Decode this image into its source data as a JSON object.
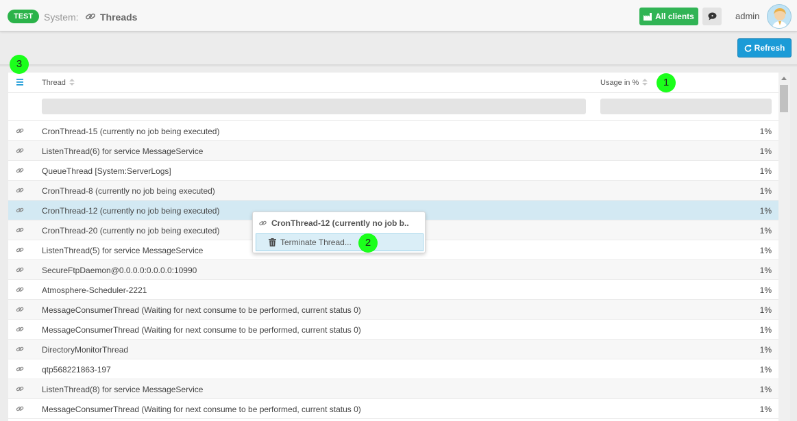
{
  "header": {
    "env_badge": "TEST",
    "breadcrumb_system": "System:",
    "breadcrumb_title": "Threads",
    "all_clients_label": "All clients",
    "user_name": "admin"
  },
  "toolbar": {
    "refresh_label": "Refresh"
  },
  "markers": {
    "m1": "1",
    "m2": "2",
    "m3": "3"
  },
  "table": {
    "columns": {
      "thread": "Thread",
      "usage": "Usage in %"
    },
    "rows": [
      {
        "name": "CronThread-15 (currently no job being executed)",
        "usage": "1%"
      },
      {
        "name": "ListenThread(6) for service MessageService",
        "usage": "1%"
      },
      {
        "name": "QueueThread [System:ServerLogs]",
        "usage": "1%"
      },
      {
        "name": "CronThread-8 (currently no job being executed)",
        "usage": "1%"
      },
      {
        "name": "CronThread-12 (currently no job being executed)",
        "usage": "1%"
      },
      {
        "name": "CronThread-20 (currently no job being executed)",
        "usage": "1%"
      },
      {
        "name": "ListenThread(5) for service MessageService",
        "usage": "1%"
      },
      {
        "name": "SecureFtpDaemon@0.0.0.0:0.0.0.0:10990",
        "usage": "1%"
      },
      {
        "name": "Atmosphere-Scheduler-2221",
        "usage": "1%"
      },
      {
        "name": "MessageConsumerThread (Waiting for next consume to be performed, current status 0)",
        "usage": "1%"
      },
      {
        "name": "MessageConsumerThread (Waiting for next consume to be performed, current status 0)",
        "usage": "1%"
      },
      {
        "name": "DirectoryMonitorThread",
        "usage": "1%"
      },
      {
        "name": "qtp568221863-197",
        "usage": "1%"
      },
      {
        "name": "ListenThread(8) for service MessageService",
        "usage": "1%"
      },
      {
        "name": "MessageConsumerThread (Waiting for next consume to be performed, current status 0)",
        "usage": "1%"
      }
    ]
  },
  "context_menu": {
    "title": "CronThread-12 (currently no job b..",
    "terminate_label": "Terminate Thread..."
  },
  "colors": {
    "accent": "#1b9bd7",
    "green": "#31b455",
    "selected": "#d3e9f3"
  }
}
